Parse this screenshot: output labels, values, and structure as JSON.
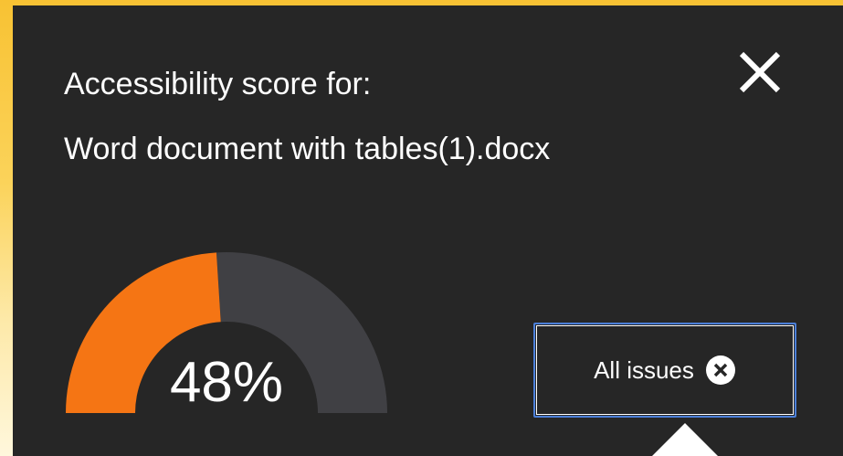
{
  "panel": {
    "title": "Accessibility score for:",
    "filename": "Word document with tables(1).docx",
    "close_icon": "close-icon"
  },
  "score": {
    "value": 48,
    "label": "48%",
    "colors": {
      "filled": "#f57514",
      "remaining": "#404044"
    }
  },
  "issues_button": {
    "label": "All issues",
    "icon": "circle-x-icon"
  }
}
